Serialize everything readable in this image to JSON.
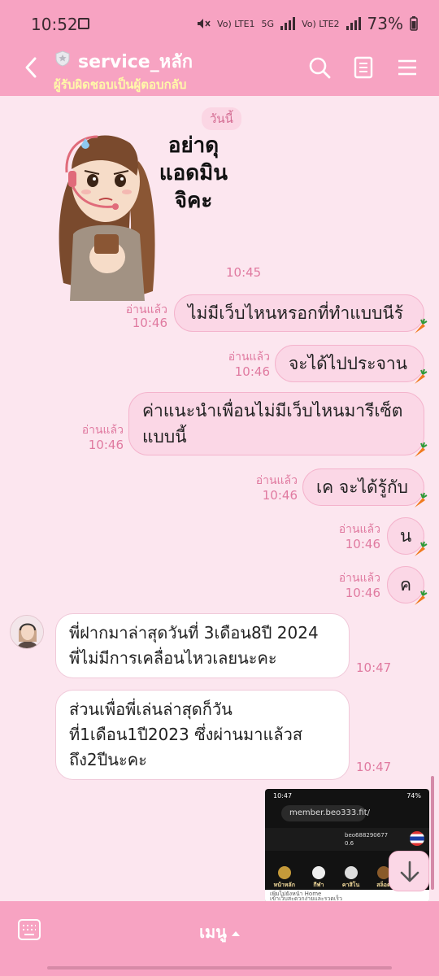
{
  "status_bar": {
    "time": "10:52",
    "sim1": "Vo) LTE1",
    "network": "5G",
    "sim2": "Vo) LTE2",
    "battery": "73%"
  },
  "header": {
    "title": "service_หลัก",
    "subtitle": "ผู้รับผิดชอบเป็นผู้ตอบกลับ",
    "icons": [
      "back-arrow-icon",
      "shield-icon",
      "search-icon",
      "notes-icon",
      "hamburger-menu-icon"
    ]
  },
  "chat": {
    "date_label": "วันนี้",
    "sticker": {
      "text": "อย่าดุ แอดมิน จิคะ",
      "time": "10:45"
    },
    "outgoing": [
      {
        "text": "ไม่มีเว็บไหนหรอกที่ทำแบบนีร้",
        "read": "อ่านแล้ว",
        "time": "10:46"
      },
      {
        "text": "จะได้ไปประจาน",
        "read": "อ่านแล้ว",
        "time": "10:46"
      },
      {
        "line1": "ค่าแนะนำเพื่อนไม่มีเว็บไหนมารีเซ็ต",
        "line2": "แบบนี้",
        "read": "อ่านแล้ว",
        "time": "10:46"
      },
      {
        "text": "เค จะได้รู้กับ",
        "read": "อ่านแล้ว",
        "time": "10:46"
      },
      {
        "text": "น",
        "read": "อ่านแล้ว",
        "time": "10:46"
      },
      {
        "text": "ค",
        "read": "อ่านแล้ว",
        "time": "10:46"
      }
    ],
    "incoming": [
      {
        "line1": "พี่ฝากมาล่าสุดวันที่ 3เดือน8ปี 2024",
        "line2": "พี่ไม่มีการเคลื่อนไหวเลยนะคะ",
        "time": "10:47"
      },
      {
        "line1": "ส่วนเพื่อพี่เล่นล่าสุดก็วัน",
        "line2": "ที่1เดือน1ปี2023 ซึ่งผ่านมาแล้วส",
        "line3": "ถึง2ปีนะคะ",
        "time": "10:47"
      }
    ],
    "screenshot": {
      "time": "10:47",
      "battery": "74%",
      "url": "member.beo333.fit/",
      "username": "beo688290677",
      "balance": "0.6",
      "menu": [
        "หน้าหลัก",
        "กีฬา",
        "คาสิโน",
        "สล็อต",
        ""
      ],
      "bottom_line1": "เพิ่มไปยังหน้า Home",
      "bottom_line2": "เข้าเว็บสะดวกง่ายและรวดเร็ว"
    }
  },
  "bottom_bar": {
    "menu_label": "เมนู"
  },
  "colors": {
    "bar_pink": "#f7a3c2",
    "chat_bg": "#fce6ef",
    "outgoing_bubble": "#fbd7e6",
    "incoming_bubble": "#ffffff",
    "accent_text": "#e07aa0",
    "subtitle_yellow": "#fff9a8"
  }
}
